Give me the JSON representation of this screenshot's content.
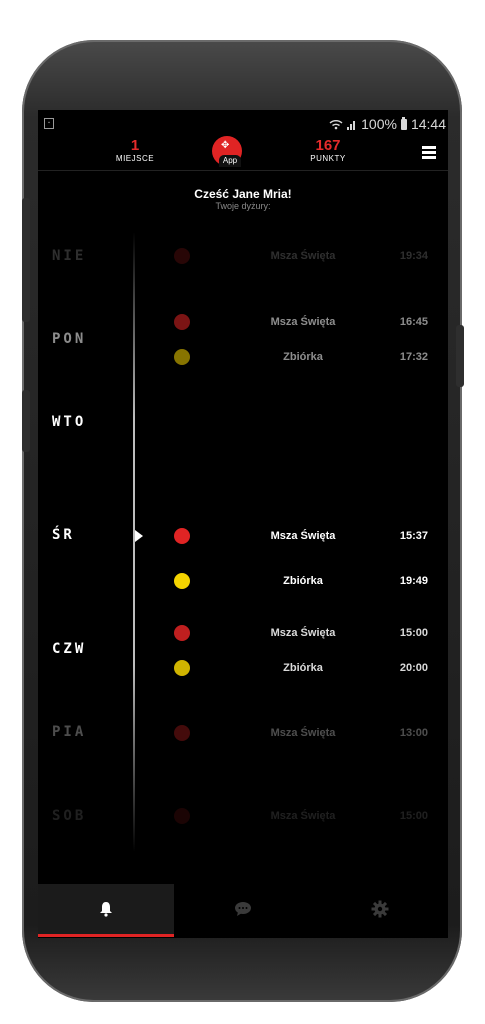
{
  "status_bar": {
    "battery": "100%",
    "time": "14:44"
  },
  "header": {
    "place_value": "1",
    "place_label": "MIEJSCE",
    "logo_text": "App",
    "points_value": "167",
    "points_label": "PUNKTY"
  },
  "greeting": {
    "title": "Cześć Jane Mria!",
    "subtitle": "Twoje dyżury:"
  },
  "days": [
    {
      "label": "NIE",
      "events": [
        {
          "name": "Msza Święta",
          "time": "19:34",
          "color": "#e02424"
        }
      ]
    },
    {
      "label": "PON",
      "events": [
        {
          "name": "Msza Święta",
          "time": "16:45",
          "color": "#e02424"
        },
        {
          "name": "Zbiórka",
          "time": "17:32",
          "color": "#f5d400"
        }
      ]
    },
    {
      "label": "WTO",
      "events": []
    },
    {
      "label": "ŚR",
      "events": [
        {
          "name": "Msza Święta",
          "time": "15:37",
          "color": "#e02424"
        },
        {
          "name": "Zbiórka",
          "time": "19:49",
          "color": "#f5d400"
        }
      ]
    },
    {
      "label": "CZW",
      "events": [
        {
          "name": "Msza Święta",
          "time": "15:00",
          "color": "#e02424"
        },
        {
          "name": "Zbiórka",
          "time": "20:00",
          "color": "#f5d400"
        }
      ]
    },
    {
      "label": "PIA",
      "events": [
        {
          "name": "Msza Święta",
          "time": "13:00",
          "color": "#e02424"
        }
      ]
    },
    {
      "label": "SOB",
      "events": [
        {
          "name": "Msza Święta",
          "time": "15:00",
          "color": "#e02424"
        }
      ]
    }
  ],
  "nav": {
    "active": "bell-icon",
    "tabs": [
      "bell-icon",
      "chat-icon",
      "gear-icon"
    ]
  },
  "colors": {
    "accent": "#e02424",
    "yellow": "#f5d400",
    "background": "#000000"
  }
}
